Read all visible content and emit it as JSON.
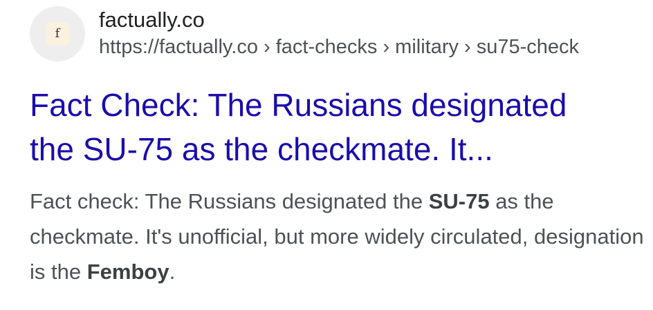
{
  "source": {
    "favicon_letter": "f",
    "site_name": "factually.co",
    "url": "https://factually.co › fact-checks › military › su75-check"
  },
  "title": {
    "line1": "Fact Check: The Russians designated",
    "line2": "the SU-75 as the checkmate. It..."
  },
  "snippet": {
    "text1": "Fact check: The Russians designated the ",
    "bold1": "SU-75",
    "text2": " as the checkmate. It's unofficial, but more widely circulated, designation is the ",
    "bold2": "Femboy",
    "text3": "."
  },
  "colors": {
    "link": "#1a0dab",
    "site_name": "#202124",
    "url": "#4d5156",
    "snippet": "#4d5156",
    "favicon_background": "#eeeeef",
    "favicon_tile": "#fbf1df"
  }
}
